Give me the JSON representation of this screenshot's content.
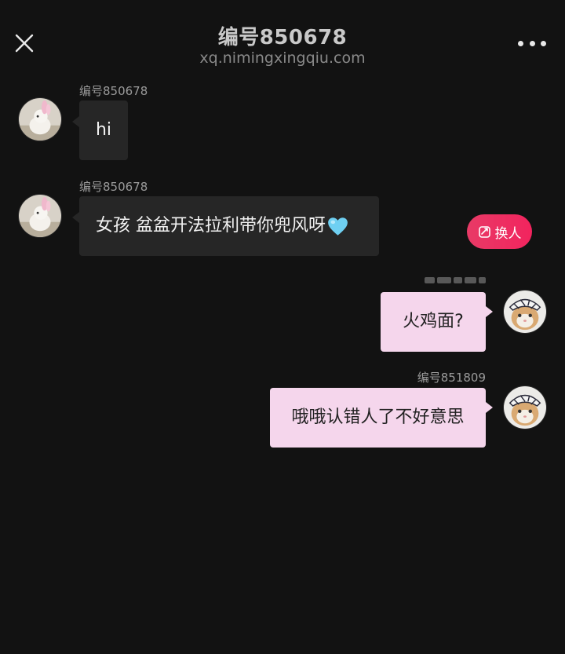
{
  "header": {
    "title": "编号850678",
    "subtitle": "xq.nimingxingqiu.com",
    "close_icon": "close-icon",
    "more_icon": "more-dots-icon"
  },
  "switch_button": {
    "label": "换人",
    "icon": "switch-person-icon",
    "color": "#ef2d5e"
  },
  "messages": [
    {
      "side": "left",
      "sender": "编号850678",
      "text": "hi",
      "avatar": "rabbit-avatar"
    },
    {
      "side": "left",
      "sender": "编号850678",
      "text": "女孩 盆盆开法拉利带你兜风呀",
      "emoji": "light-blue-heart",
      "avatar": "rabbit-avatar"
    },
    {
      "side": "right",
      "sender": "",
      "sender_blurred": true,
      "text": "火鸡面?",
      "avatar": "cat-avatar"
    },
    {
      "side": "right",
      "sender": "编号851809",
      "text": "哦哦认错人了不好意思",
      "avatar": "cat-avatar"
    }
  ],
  "colors": {
    "background": "#121212",
    "incoming_bubble": "#262626",
    "outgoing_bubble": "#f5d6ec",
    "heart": "#6fd0f2"
  }
}
